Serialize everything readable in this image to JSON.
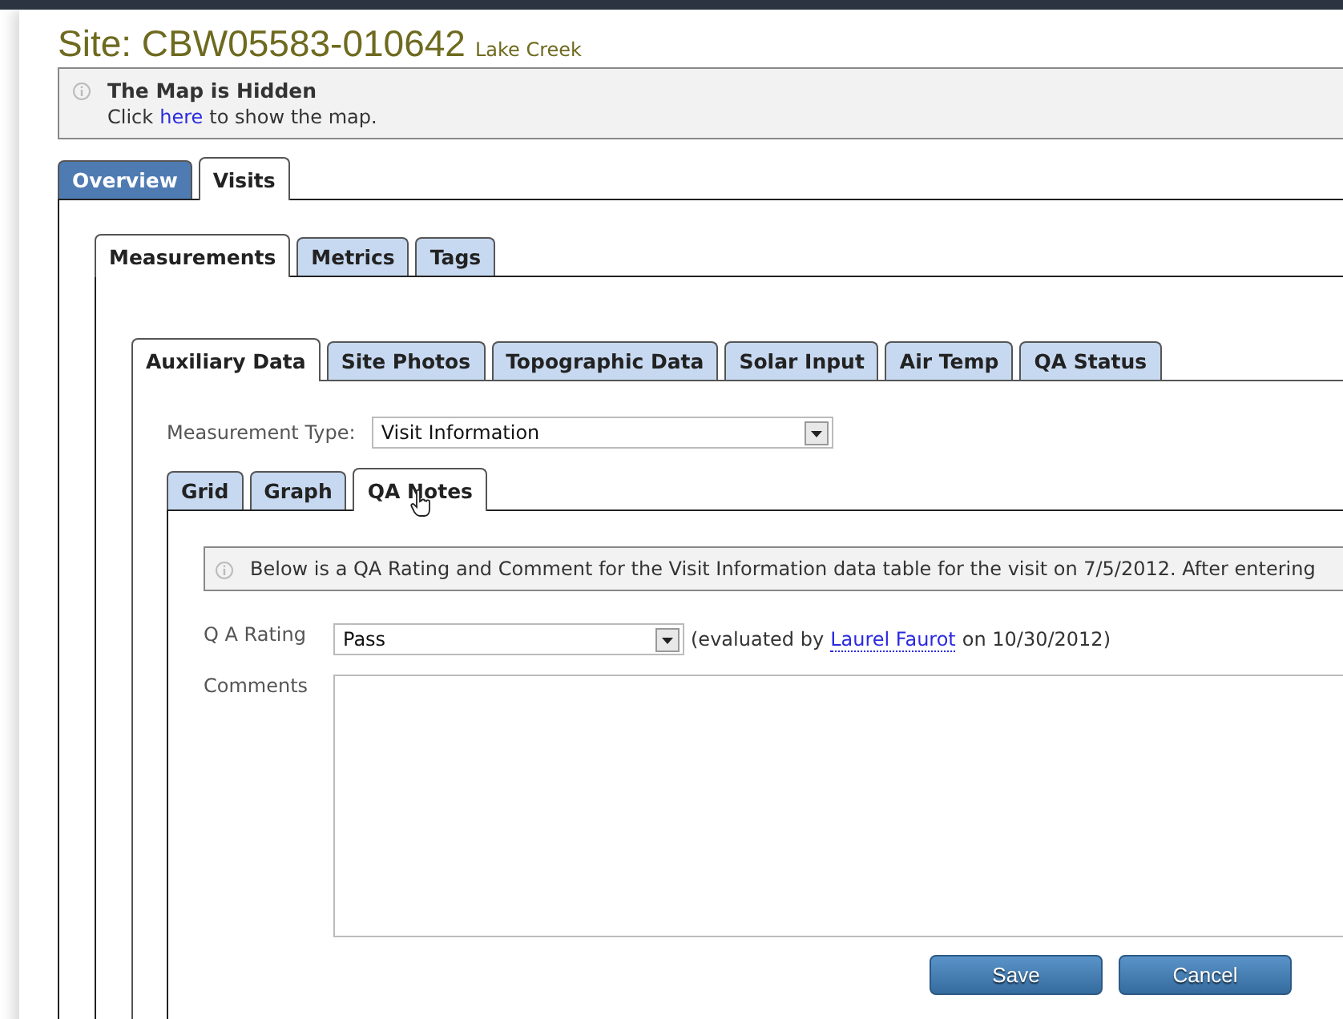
{
  "site": {
    "label": "Site:",
    "code": "CBW05583-010642",
    "name": "Lake Creek"
  },
  "map_notice": {
    "title": "The Map is Hidden",
    "before": "Click",
    "link": "here",
    "after": "to show the map."
  },
  "main_tabs": [
    {
      "label": "Overview",
      "selected": false,
      "highlighted": true
    },
    {
      "label": "Visits",
      "selected": true,
      "highlighted": false
    }
  ],
  "visit_tabs": [
    {
      "label": "Measurements",
      "selected": true
    },
    {
      "label": "Metrics",
      "selected": false
    },
    {
      "label": "Tags",
      "selected": false
    }
  ],
  "measurement_tabs": [
    {
      "label": "Auxiliary Data",
      "selected": true
    },
    {
      "label": "Site Photos",
      "selected": false
    },
    {
      "label": "Topographic Data",
      "selected": false
    },
    {
      "label": "Solar Input",
      "selected": false
    },
    {
      "label": "Air Temp",
      "selected": false
    },
    {
      "label": "QA Status",
      "selected": false
    }
  ],
  "measurement_type": {
    "label": "Measurement Type:",
    "value": "Visit Information"
  },
  "view_tabs": [
    {
      "label": "Grid",
      "selected": false
    },
    {
      "label": "Graph",
      "selected": false
    },
    {
      "label": "QA Notes",
      "selected": true
    }
  ],
  "qa_notice": "Below is a QA Rating and Comment for the Visit Information data table for the visit on 7/5/2012. After entering",
  "qa_rating": {
    "label": "Q A Rating",
    "value": "Pass",
    "evaluated_before": "(evaluated by",
    "evaluator": "Laurel Faurot",
    "evaluated_after": "on 10/30/2012)"
  },
  "comments": {
    "label": "Comments"
  },
  "buttons": [
    "Save",
    "Cancel"
  ]
}
